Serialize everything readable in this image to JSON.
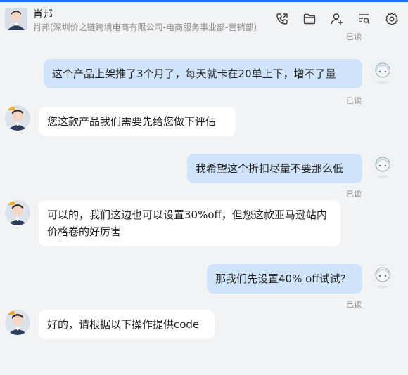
{
  "header": {
    "name": "肖邦",
    "subtitle": "肖邦(深圳价之链跨境电商有限公司-电商服务事业部-营销部)",
    "icons": [
      "phone-icon",
      "folder-icon",
      "add-user-icon",
      "search-list-icon",
      "settings-icon"
    ]
  },
  "top_status": "已读",
  "messages": [
    {
      "side": "out",
      "text": "这个产品上架推了3个月了，每天就卡在20单上下，增不了量",
      "status": "已读"
    },
    {
      "side": "in",
      "text": "您这款产品我们需要先给您做下评估"
    },
    {
      "side": "out",
      "text": "我希望这个折扣尽量不要那么低",
      "status": "已读"
    },
    {
      "side": "in",
      "text": "可以的，我们这边也可以设置30%off，但您这款亚马逊站内价格卷的好厉害"
    },
    {
      "side": "out",
      "text": "那我们先设置40% off试试?",
      "status": "已读"
    },
    {
      "side": "in",
      "text": "好的，请根据以下操作提供code"
    }
  ],
  "colors": {
    "accent": "#1677ff",
    "bubble_out": "#cfe4fb",
    "bubble_in": "#ffffff",
    "background": "#f2f3f5"
  }
}
